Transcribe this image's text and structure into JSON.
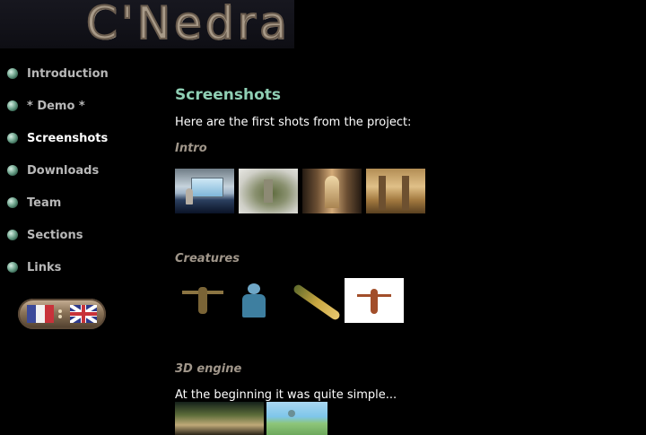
{
  "logo": {
    "text": "C'Nedra"
  },
  "nav": {
    "items": [
      {
        "label": "Introduction"
      },
      {
        "label": "* Demo *"
      },
      {
        "label": "Screenshots"
      },
      {
        "label": "Downloads"
      },
      {
        "label": "Team"
      },
      {
        "label": "Sections"
      },
      {
        "label": "Links"
      }
    ],
    "active": "Screenshots"
  },
  "language": {
    "options": [
      "fr-flag",
      "uk-flag"
    ]
  },
  "main": {
    "title": "Screenshots",
    "intro": "Here are the first shots from the project:",
    "sections": [
      {
        "heading": "Intro"
      },
      {
        "heading": "Creatures"
      },
      {
        "heading": "3D engine",
        "text": "At the beginning it was quite simple..."
      }
    ]
  },
  "colors": {
    "title": "#8fcfb4",
    "nav_text": "#b8b8b8",
    "nav_active": "#ffffff",
    "section_heading": "#a0968a",
    "background": "#000000"
  }
}
